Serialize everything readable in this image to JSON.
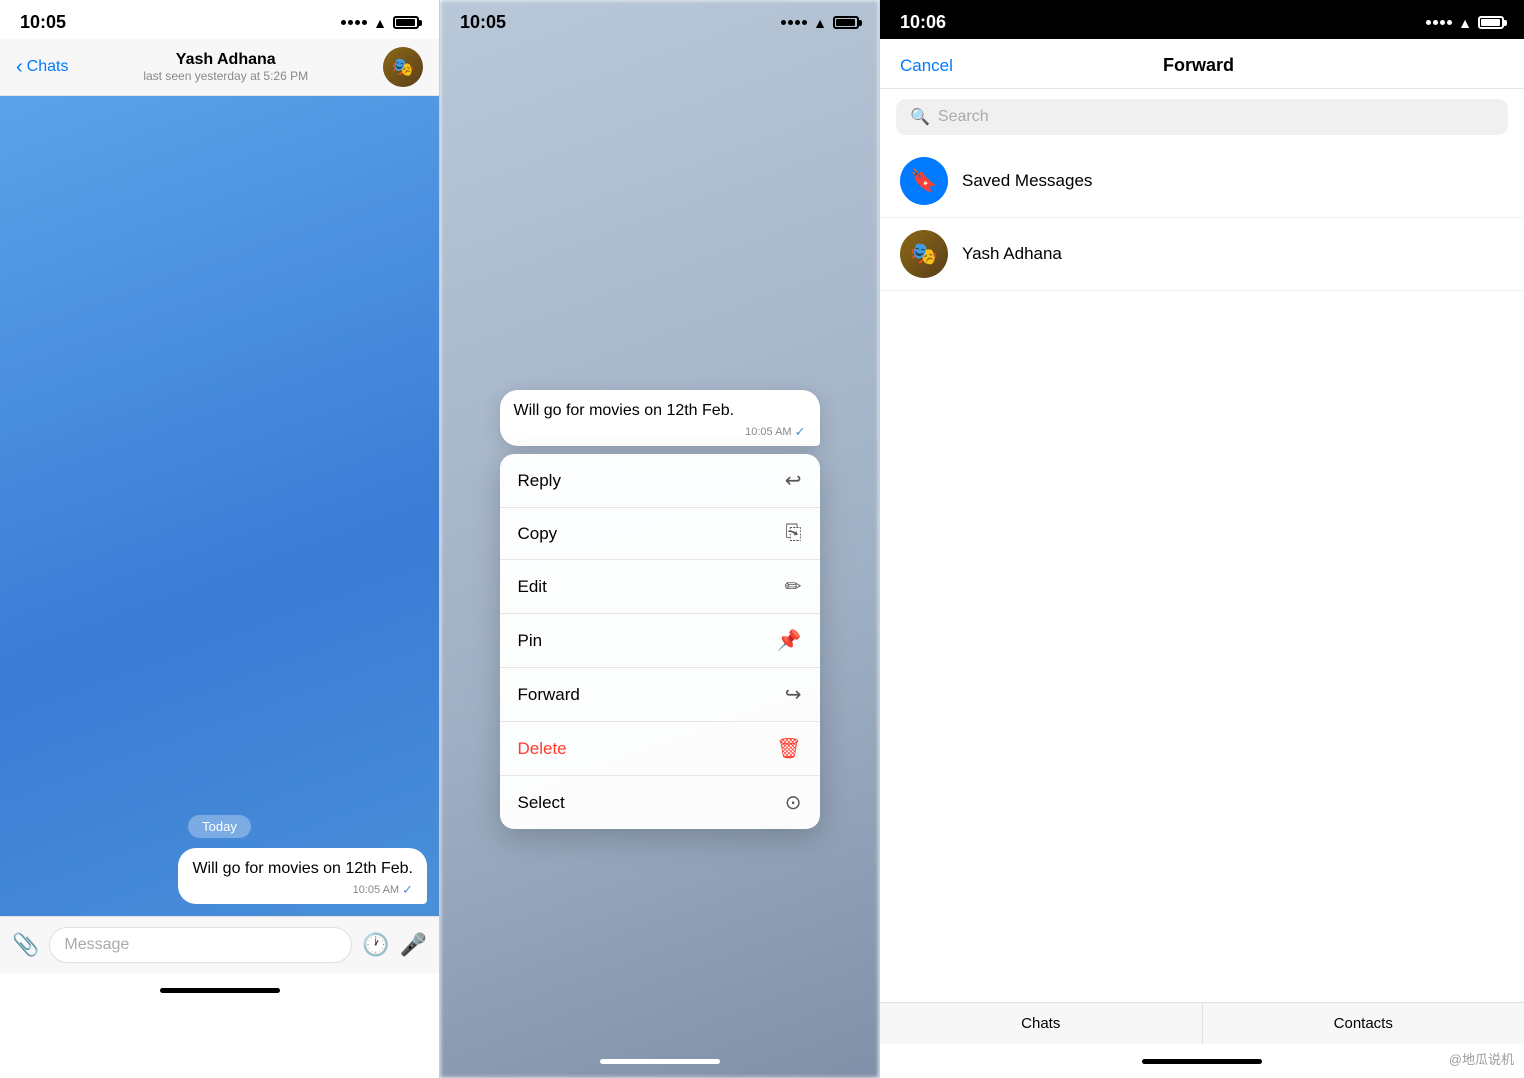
{
  "phone1": {
    "status": {
      "time": "10:05",
      "signal": "....",
      "wifi": "wifi",
      "battery": "battery"
    },
    "header": {
      "back_label": "Chats",
      "name": "Yash Adhana",
      "status_text": "last seen yesterday at 5:26 PM"
    },
    "chat": {
      "date_badge": "Today",
      "message_text": "Will go for movies on 12th Feb.",
      "message_time": "10:05 AM",
      "checkmark": "✓"
    },
    "input": {
      "placeholder": "Message",
      "attachment_icon": "📎",
      "sticker_icon": "🕐",
      "mic_icon": "🎤"
    }
  },
  "phone2": {
    "status": {
      "time": "10:05"
    },
    "context_message": {
      "text": "Will go for movies on 12th Feb.",
      "time": "10:05 AM",
      "checkmark": "✓"
    },
    "menu_items": [
      {
        "label": "Reply",
        "icon": "↩",
        "color": "normal"
      },
      {
        "label": "Copy",
        "icon": "⎘",
        "color": "normal"
      },
      {
        "label": "Edit",
        "icon": "✏",
        "color": "normal"
      },
      {
        "label": "Pin",
        "icon": "📌",
        "color": "normal"
      },
      {
        "label": "Forward",
        "icon": "↪",
        "color": "normal"
      },
      {
        "label": "Delete",
        "icon": "🗑",
        "color": "delete"
      },
      {
        "label": "Select",
        "icon": "⊙",
        "color": "normal"
      }
    ]
  },
  "phone3": {
    "status": {
      "time": "10:06"
    },
    "header": {
      "cancel_label": "Cancel",
      "title": "Forward"
    },
    "search": {
      "placeholder": "Search"
    },
    "contacts": [
      {
        "name": "Saved Messages",
        "type": "saved"
      },
      {
        "name": "Yash Adhana",
        "type": "yash"
      }
    ],
    "bottom_tabs": [
      {
        "label": "Chats"
      },
      {
        "label": "Contacts"
      }
    ]
  },
  "watermark": "@地瓜说机"
}
